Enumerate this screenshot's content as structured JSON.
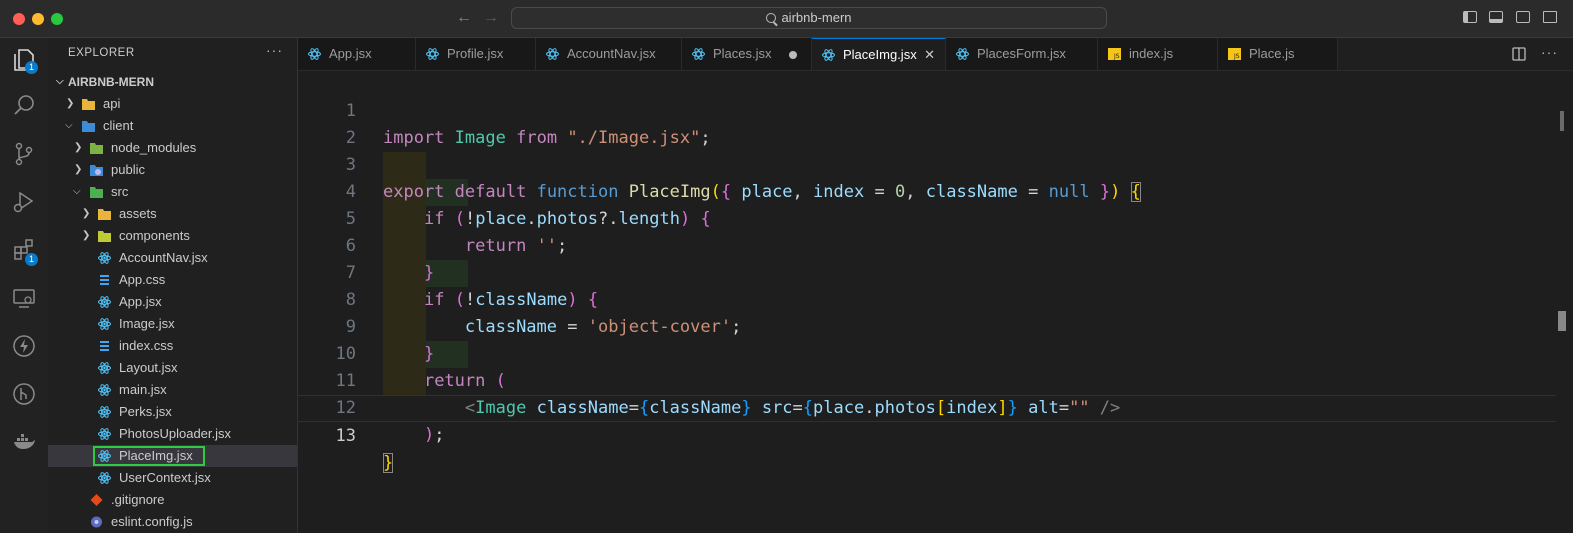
{
  "window": {
    "title": "airbnb-mern"
  },
  "sidebar": {
    "header": "EXPLORER",
    "more": "···",
    "root": "AIRBNB-MERN",
    "items": [
      {
        "label": "api"
      },
      {
        "label": "client"
      },
      {
        "label": "node_modules"
      },
      {
        "label": "public"
      },
      {
        "label": "src"
      },
      {
        "label": "assets"
      },
      {
        "label": "components"
      },
      {
        "label": "AccountNav.jsx"
      },
      {
        "label": "App.css"
      },
      {
        "label": "App.jsx"
      },
      {
        "label": "Image.jsx"
      },
      {
        "label": "index.css"
      },
      {
        "label": "Layout.jsx"
      },
      {
        "label": "main.jsx"
      },
      {
        "label": "Perks.jsx"
      },
      {
        "label": "PhotosUploader.jsx"
      },
      {
        "label": "PlaceImg.jsx"
      },
      {
        "label": "UserContext.jsx"
      },
      {
        "label": ".gitignore"
      },
      {
        "label": "eslint.config.js"
      }
    ]
  },
  "activity": {
    "explorer_badge": "1",
    "extensions_badge": "1"
  },
  "tabs": [
    {
      "label": "App.jsx"
    },
    {
      "label": "Profile.jsx"
    },
    {
      "label": "AccountNav.jsx"
    },
    {
      "label": "Places.jsx"
    },
    {
      "label": "PlaceImg.jsx"
    },
    {
      "label": "PlacesForm.jsx"
    },
    {
      "label": "index.js"
    },
    {
      "label": "Place.js"
    }
  ],
  "tab_close": "✕",
  "editor": {
    "line_numbers": [
      "1",
      "2",
      "3",
      "4",
      "5",
      "6",
      "7",
      "8",
      "9",
      "10",
      "11",
      "12",
      "13"
    ],
    "tokens": {
      "import": "import",
      "Image": "Image",
      "from": "from",
      "image_path": "\"./Image.jsx\"",
      "semi": ";",
      "export": "export",
      "default": "default",
      "function": "function",
      "fname": "PlaceImg",
      "paren_open": "(",
      "brace_open": "{",
      "place": "place",
      "comma": ",",
      "index": "index",
      "eq": "=",
      "zero": "0",
      "className": "className",
      "null": "null",
      "brace_close": "}",
      "paren_close": ")",
      "if": "if",
      "not": "!",
      "dot": ".",
      "photos": "photos",
      "optchain": "?.",
      "length": "length",
      "return": "return",
      "empty_str": "''",
      "object_cover": "'object-cover'",
      "lt": "<",
      "src": "src",
      "bracket_open": "[",
      "bracket_close": "]",
      "alt": "alt",
      "empty_dq": "\"\"",
      "self_close": "/>"
    }
  }
}
